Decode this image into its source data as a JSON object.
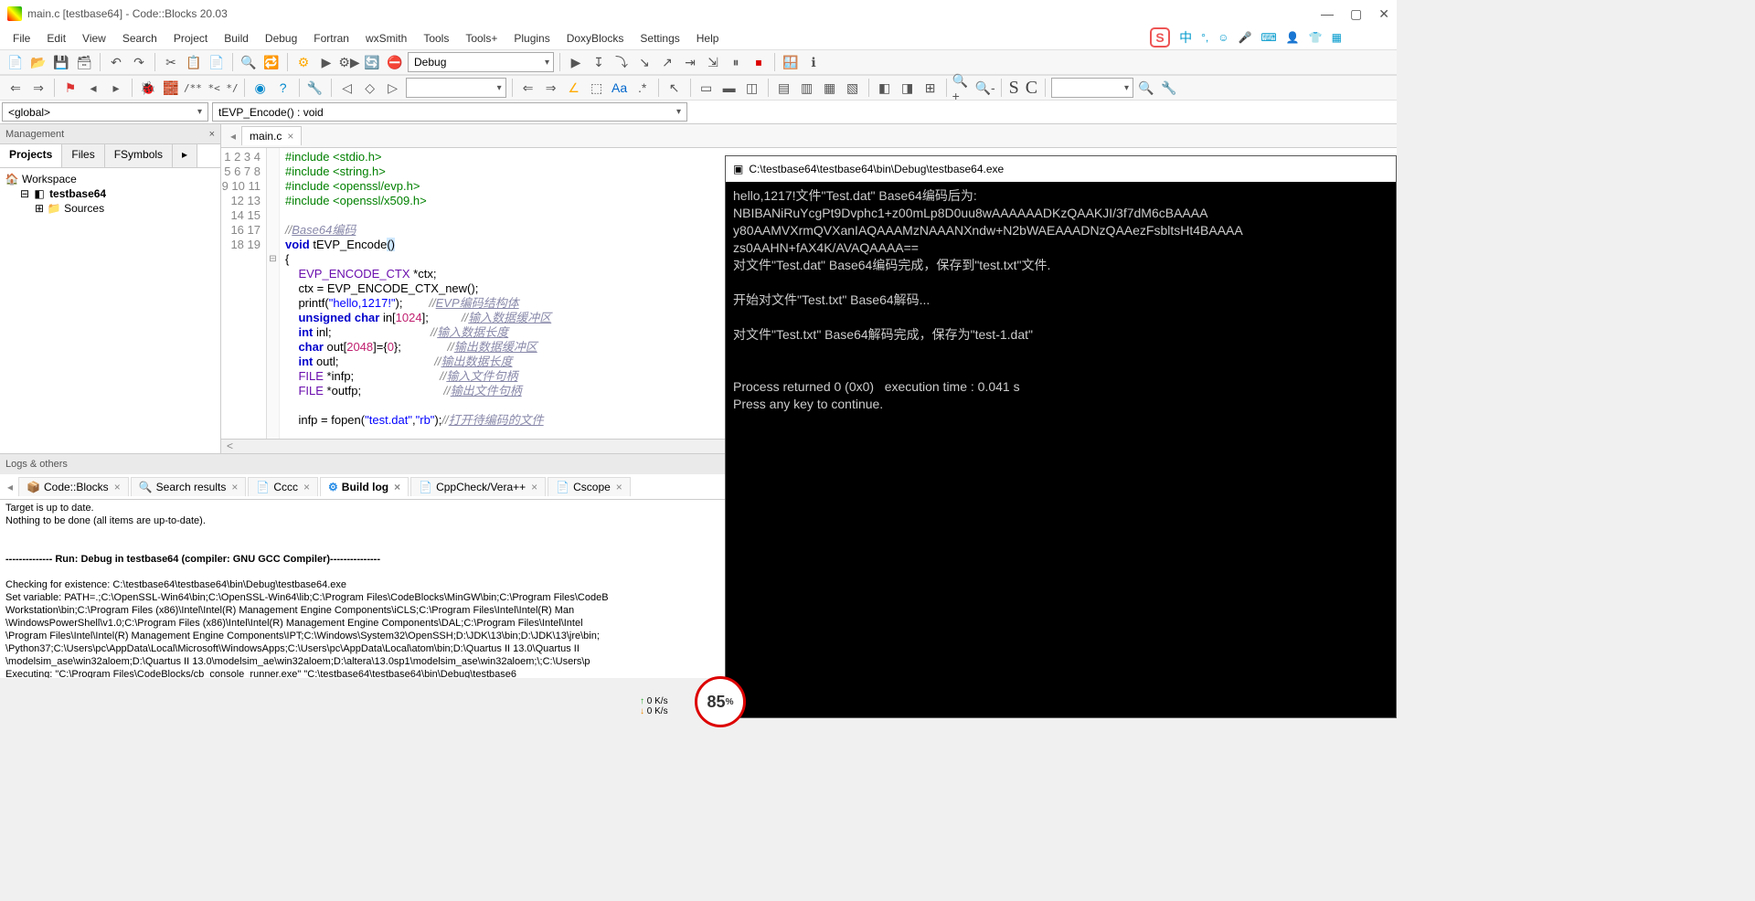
{
  "title": "main.c [testbase64] - Code::Blocks 20.03",
  "menu": [
    "File",
    "Edit",
    "View",
    "Search",
    "Project",
    "Build",
    "Debug",
    "Fortran",
    "wxSmith",
    "Tools",
    "Tools+",
    "Plugins",
    "DoxyBlocks",
    "Settings",
    "Help"
  ],
  "toolbar_config_dropdown": "Debug",
  "comment_token": "/** *< */",
  "scope_left": "<global>",
  "scope_right": "tEVP_Encode() : void",
  "mgmt_title": "Management",
  "mgmt_tabs": [
    "Projects",
    "Files",
    "FSymbols"
  ],
  "tree": {
    "workspace": "Workspace",
    "project": "testbase64",
    "sources": "Sources"
  },
  "editor_tab": "main.c",
  "code_lines": [
    {
      "n": 1,
      "h": "<span class='pp'>#include &lt;stdio.h&gt;</span>"
    },
    {
      "n": 2,
      "h": "<span class='pp'>#include &lt;string.h&gt;</span>"
    },
    {
      "n": 3,
      "h": "<span class='pp'>#include &lt;openssl/evp.h&gt;</span>"
    },
    {
      "n": 4,
      "h": "<span class='pp'>#include &lt;openssl/x509.h&gt;</span>"
    },
    {
      "n": 5,
      "h": ""
    },
    {
      "n": 6,
      "h": "<span class='cm'>//<a>Base64编码</a></span>"
    },
    {
      "n": 7,
      "h": "<span class='kw'>void</span> <span class='fn'>tEVP_Encode</span><span style='background:#cfe8ff'>()</span>"
    },
    {
      "n": 8,
      "h": "{"
    },
    {
      "n": 9,
      "h": "    <span class='ty'>EVP_ENCODE_CTX</span> *ctx;"
    },
    {
      "n": 10,
      "h": "    ctx = <span class='fn'>EVP_ENCODE_CTX_new</span>();"
    },
    {
      "n": 11,
      "h": "    <span class='fn'>printf</span>(<span class='str'>\"hello,1217!\"</span>);        <span class='cm'>//<a>EVP编码结构体</a></span>"
    },
    {
      "n": 12,
      "h": "    <span class='kw'>unsigned</span> <span class='kw'>char</span> in[<span class='num'>1024</span>];          <span class='cm'>//<a>输入数据缓冲区</a></span>"
    },
    {
      "n": 13,
      "h": "    <span class='kw'>int</span> inl;                              <span class='cm'>//<a>输入数据长度</a></span>"
    },
    {
      "n": 14,
      "h": "    <span class='kw'>char</span> out[<span class='num'>2048</span>]={<span class='num'>0</span>};              <span class='cm'>//<a>输出数据缓冲区</a></span>"
    },
    {
      "n": 15,
      "h": "    <span class='kw'>int</span> outl;                             <span class='cm'>//<a>输出数据长度</a></span>"
    },
    {
      "n": 16,
      "h": "    <span class='ty'>FILE</span> *infp;                          <span class='cm'>//<a>输入文件句柄</a></span>"
    },
    {
      "n": 17,
      "h": "    <span class='ty'>FILE</span> *outfp;                         <span class='cm'>//<a>输出文件句柄</a></span>"
    },
    {
      "n": 18,
      "h": ""
    },
    {
      "n": 19,
      "h": "    infp = <span class='fn'>fopen</span>(<span class='str'>\"test.dat\"</span>,<span class='str'>\"rb\"</span>);<span class='cm'>//<a>打开待编码的文件</a></span>"
    }
  ],
  "logs_title": "Logs & others",
  "logs_tabs": [
    {
      "icon": "📦",
      "label": "Code::Blocks"
    },
    {
      "icon": "🔍",
      "label": "Search results"
    },
    {
      "icon": "📄",
      "label": "Cccc"
    },
    {
      "icon": "⚙",
      "label": "Build log",
      "active": true,
      "color": "#1e88e5"
    },
    {
      "icon": "📄",
      "label": "CppCheck/Vera++"
    },
    {
      "icon": "📄",
      "label": "Cscope"
    }
  ],
  "build_log_pre": "Target is up to date.\nNothing to be done (all items are up-to-date).\n\n\n",
  "build_log_run": "-------------- Run: Debug in testbase64 (compiler: GNU GCC Compiler)---------------",
  "build_log_post": "\n\nChecking for existence: C:\\testbase64\\testbase64\\bin\\Debug\\testbase64.exe\nSet variable: PATH=.;C:\\OpenSSL-Win64\\bin;C:\\OpenSSL-Win64\\lib;C:\\Program Files\\CodeBlocks\\MinGW\\bin;C:\\Program Files\\CodeB\nWorkstation\\bin;C:\\Program Files (x86)\\Intel\\Intel(R) Management Engine Components\\iCLS;C:\\Program Files\\Intel\\Intel(R) Man\n\\WindowsPowerShell\\v1.0;C:\\Program Files (x86)\\Intel\\Intel(R) Management Engine Components\\DAL;C:\\Program Files\\Intel\\Intel\n\\Program Files\\Intel\\Intel(R) Management Engine Components\\IPT;C:\\Windows\\System32\\OpenSSH;D:\\JDK\\13\\bin;D:\\JDK\\13\\jre\\bin;\n\\Python37;C:\\Users\\pc\\AppData\\Local\\Microsoft\\WindowsApps;C:\\Users\\pc\\AppData\\Local\\atom\\bin;D:\\Quartus II 13.0\\Quartus II \n\\modelsim_ase\\win32aloem;D:\\Quartus II 13.0\\modelsim_ae\\win32aloem;D:\\altera\\13.0sp1\\modelsim_ase\\win32aloem;\\;C:\\Users\\p\nExecuting: \"C:\\Program Files\\CodeBlocks/cb_console_runner.exe\" \"C:\\testbase64\\testbase64\\bin\\Debug\\testbase6",
  "console_title": "C:\\testbase64\\testbase64\\bin\\Debug\\testbase64.exe",
  "console_body": "hello,1217!文件\"Test.dat\" Base64编码后为:\nNBIBANiRuYcgPt9Dvphc1+z00mLp8D0uu8wAAAAAADKzQAAKJI/3f7dM6cBAAAA\ny80AAMVXrmQVXanIAQAAAMzNAAANXndw+N2bWAEAAADNzQAAezFsbltsHt4BAAAA\nzs0AAHN+fAX4K/AVAQAAAA==\n对文件\"Test.dat\" Base64编码完成，保存到\"test.txt\"文件.\n\n开始对文件\"Test.txt\" Base64解码...\n\n对文件\"Test.txt\" Base64解码完成，保存为\"test-1.dat\"\n\n\nProcess returned 0 (0x0)   execution time : 0.041 s\nPress any key to continue.",
  "net_up": "0  K/s",
  "net_dn": "0  K/s",
  "pct": "85",
  "ime_cn": "中"
}
